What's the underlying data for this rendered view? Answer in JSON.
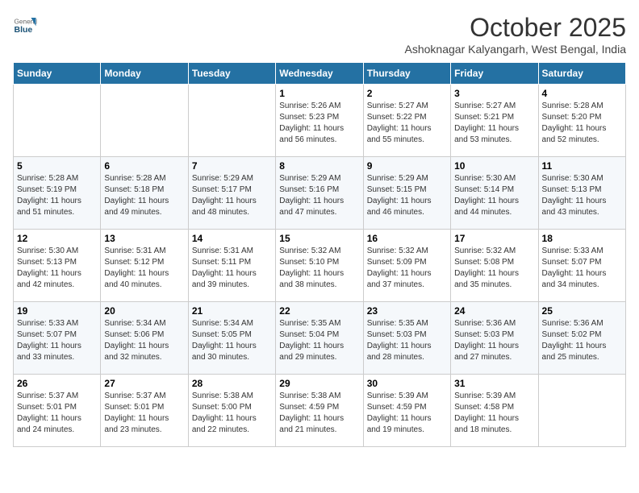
{
  "header": {
    "logo_general": "General",
    "logo_blue": "Blue",
    "month": "October 2025",
    "location": "Ashoknagar Kalyangarh, West Bengal, India"
  },
  "weekdays": [
    "Sunday",
    "Monday",
    "Tuesday",
    "Wednesday",
    "Thursday",
    "Friday",
    "Saturday"
  ],
  "weeks": [
    [
      {
        "day": "",
        "info": ""
      },
      {
        "day": "",
        "info": ""
      },
      {
        "day": "",
        "info": ""
      },
      {
        "day": "1",
        "info": "Sunrise: 5:26 AM\nSunset: 5:23 PM\nDaylight: 11 hours\nand 56 minutes."
      },
      {
        "day": "2",
        "info": "Sunrise: 5:27 AM\nSunset: 5:22 PM\nDaylight: 11 hours\nand 55 minutes."
      },
      {
        "day": "3",
        "info": "Sunrise: 5:27 AM\nSunset: 5:21 PM\nDaylight: 11 hours\nand 53 minutes."
      },
      {
        "day": "4",
        "info": "Sunrise: 5:28 AM\nSunset: 5:20 PM\nDaylight: 11 hours\nand 52 minutes."
      }
    ],
    [
      {
        "day": "5",
        "info": "Sunrise: 5:28 AM\nSunset: 5:19 PM\nDaylight: 11 hours\nand 51 minutes."
      },
      {
        "day": "6",
        "info": "Sunrise: 5:28 AM\nSunset: 5:18 PM\nDaylight: 11 hours\nand 49 minutes."
      },
      {
        "day": "7",
        "info": "Sunrise: 5:29 AM\nSunset: 5:17 PM\nDaylight: 11 hours\nand 48 minutes."
      },
      {
        "day": "8",
        "info": "Sunrise: 5:29 AM\nSunset: 5:16 PM\nDaylight: 11 hours\nand 47 minutes."
      },
      {
        "day": "9",
        "info": "Sunrise: 5:29 AM\nSunset: 5:15 PM\nDaylight: 11 hours\nand 46 minutes."
      },
      {
        "day": "10",
        "info": "Sunrise: 5:30 AM\nSunset: 5:14 PM\nDaylight: 11 hours\nand 44 minutes."
      },
      {
        "day": "11",
        "info": "Sunrise: 5:30 AM\nSunset: 5:13 PM\nDaylight: 11 hours\nand 43 minutes."
      }
    ],
    [
      {
        "day": "12",
        "info": "Sunrise: 5:30 AM\nSunset: 5:13 PM\nDaylight: 11 hours\nand 42 minutes."
      },
      {
        "day": "13",
        "info": "Sunrise: 5:31 AM\nSunset: 5:12 PM\nDaylight: 11 hours\nand 40 minutes."
      },
      {
        "day": "14",
        "info": "Sunrise: 5:31 AM\nSunset: 5:11 PM\nDaylight: 11 hours\nand 39 minutes."
      },
      {
        "day": "15",
        "info": "Sunrise: 5:32 AM\nSunset: 5:10 PM\nDaylight: 11 hours\nand 38 minutes."
      },
      {
        "day": "16",
        "info": "Sunrise: 5:32 AM\nSunset: 5:09 PM\nDaylight: 11 hours\nand 37 minutes."
      },
      {
        "day": "17",
        "info": "Sunrise: 5:32 AM\nSunset: 5:08 PM\nDaylight: 11 hours\nand 35 minutes."
      },
      {
        "day": "18",
        "info": "Sunrise: 5:33 AM\nSunset: 5:07 PM\nDaylight: 11 hours\nand 34 minutes."
      }
    ],
    [
      {
        "day": "19",
        "info": "Sunrise: 5:33 AM\nSunset: 5:07 PM\nDaylight: 11 hours\nand 33 minutes."
      },
      {
        "day": "20",
        "info": "Sunrise: 5:34 AM\nSunset: 5:06 PM\nDaylight: 11 hours\nand 32 minutes."
      },
      {
        "day": "21",
        "info": "Sunrise: 5:34 AM\nSunset: 5:05 PM\nDaylight: 11 hours\nand 30 minutes."
      },
      {
        "day": "22",
        "info": "Sunrise: 5:35 AM\nSunset: 5:04 PM\nDaylight: 11 hours\nand 29 minutes."
      },
      {
        "day": "23",
        "info": "Sunrise: 5:35 AM\nSunset: 5:03 PM\nDaylight: 11 hours\nand 28 minutes."
      },
      {
        "day": "24",
        "info": "Sunrise: 5:36 AM\nSunset: 5:03 PM\nDaylight: 11 hours\nand 27 minutes."
      },
      {
        "day": "25",
        "info": "Sunrise: 5:36 AM\nSunset: 5:02 PM\nDaylight: 11 hours\nand 25 minutes."
      }
    ],
    [
      {
        "day": "26",
        "info": "Sunrise: 5:37 AM\nSunset: 5:01 PM\nDaylight: 11 hours\nand 24 minutes."
      },
      {
        "day": "27",
        "info": "Sunrise: 5:37 AM\nSunset: 5:01 PM\nDaylight: 11 hours\nand 23 minutes."
      },
      {
        "day": "28",
        "info": "Sunrise: 5:38 AM\nSunset: 5:00 PM\nDaylight: 11 hours\nand 22 minutes."
      },
      {
        "day": "29",
        "info": "Sunrise: 5:38 AM\nSunset: 4:59 PM\nDaylight: 11 hours\nand 21 minutes."
      },
      {
        "day": "30",
        "info": "Sunrise: 5:39 AM\nSunset: 4:59 PM\nDaylight: 11 hours\nand 19 minutes."
      },
      {
        "day": "31",
        "info": "Sunrise: 5:39 AM\nSunset: 4:58 PM\nDaylight: 11 hours\nand 18 minutes."
      },
      {
        "day": "",
        "info": ""
      }
    ]
  ]
}
